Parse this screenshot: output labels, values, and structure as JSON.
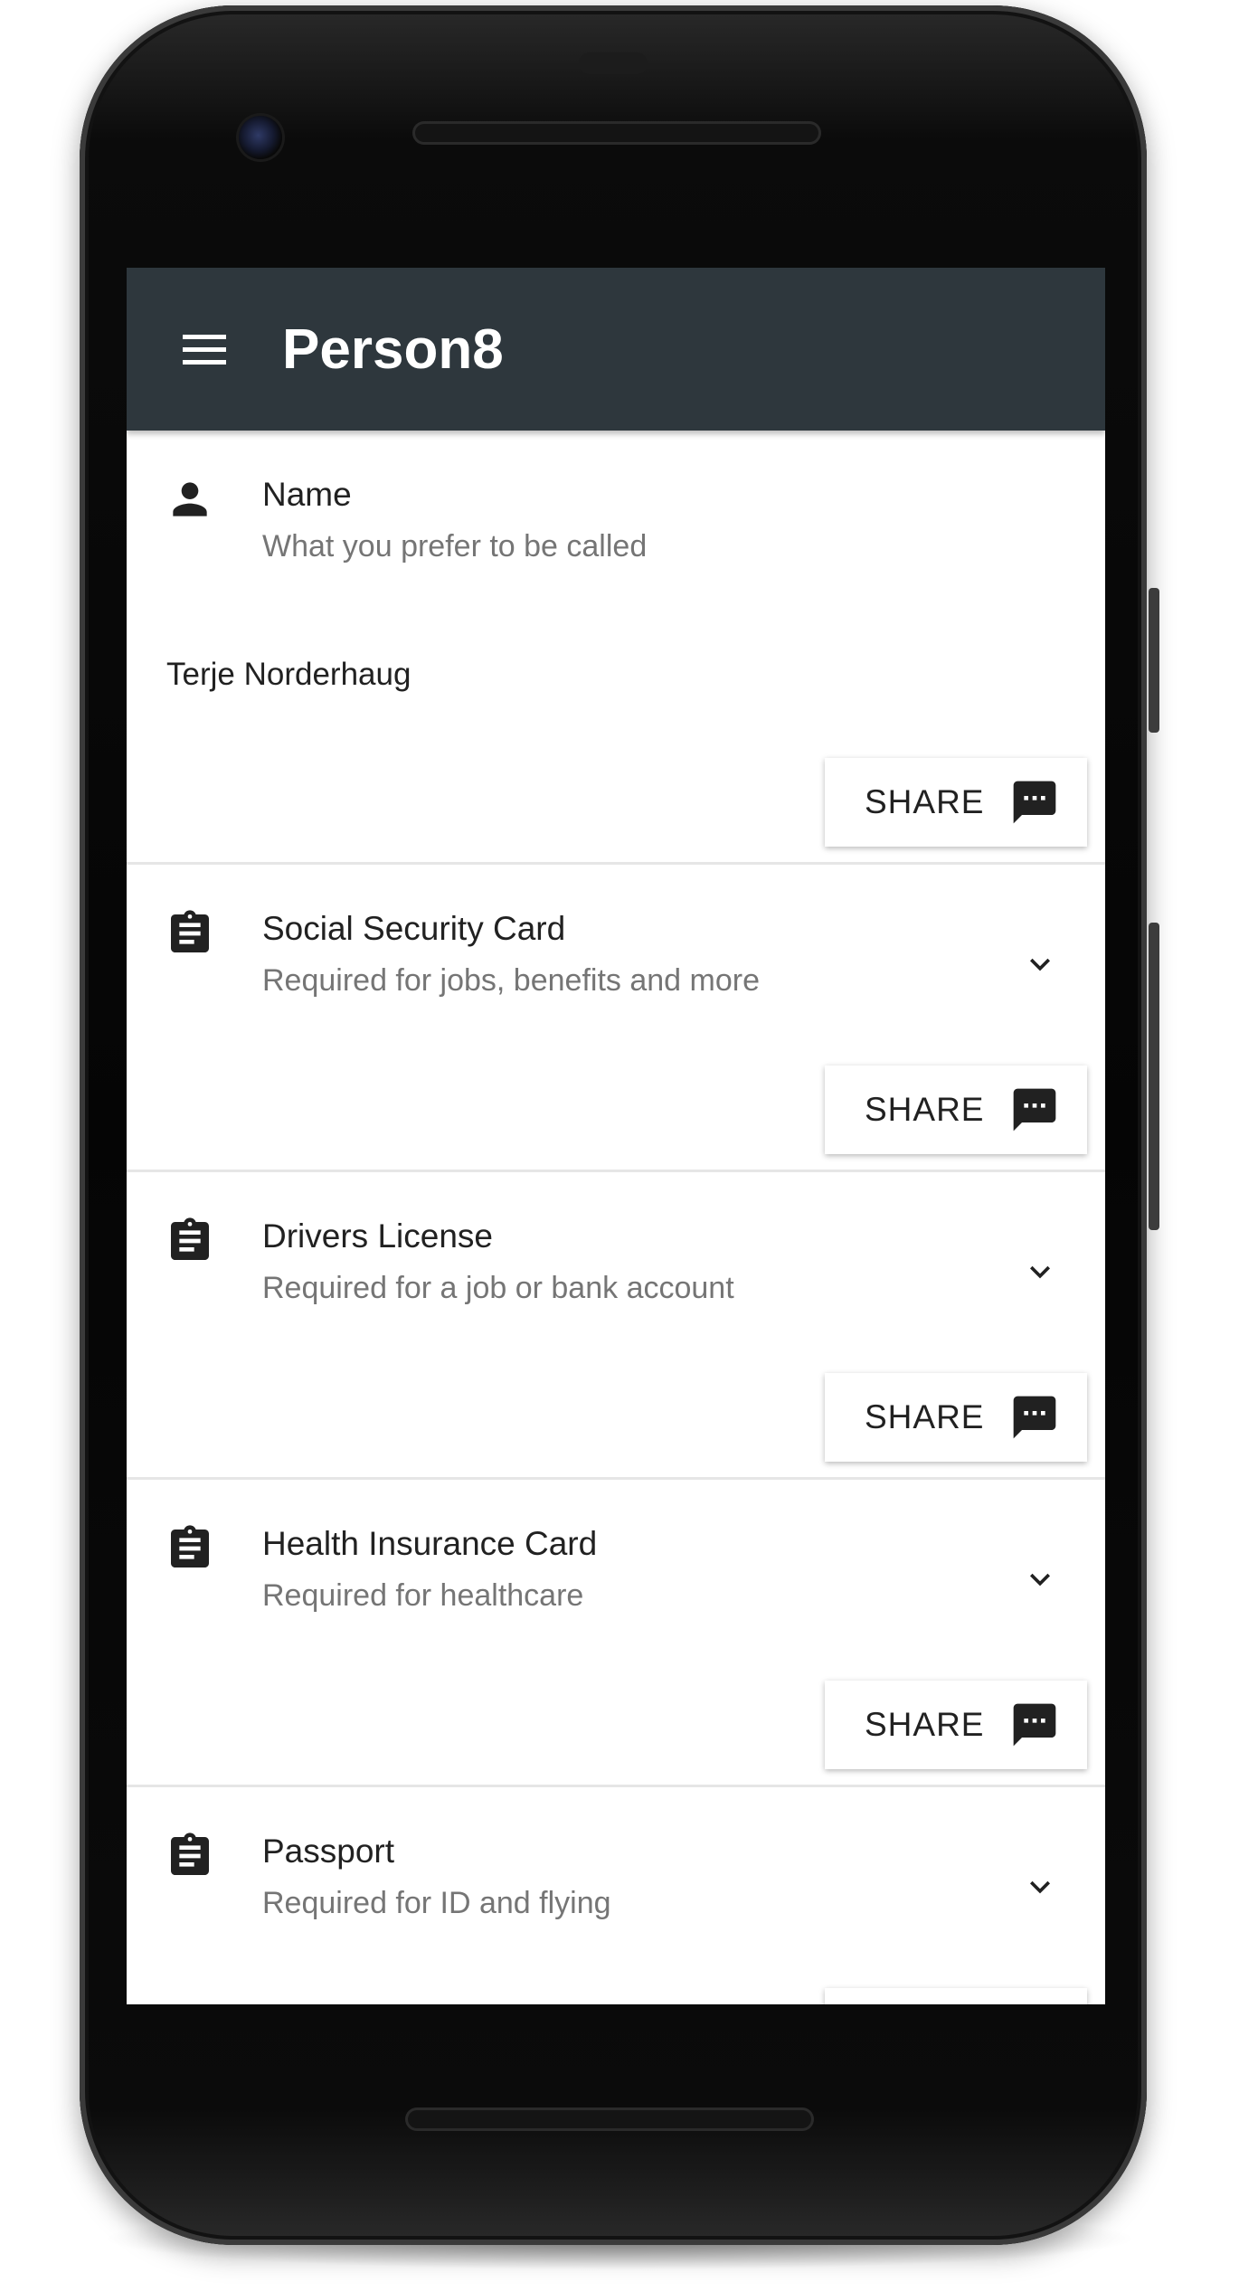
{
  "app": {
    "title": "Person8",
    "menu_icon": "hamburger-menu-icon",
    "appbar_color": "#2e373d"
  },
  "cards": [
    {
      "icon": "person-icon",
      "title": "Name",
      "subtitle": "What you prefer to be called",
      "value": "Terje Norderhaug",
      "share_label": "SHARE"
    },
    {
      "icon": "clipboard-icon",
      "title": "Social Security Card",
      "subtitle": "Required for jobs, benefits and more",
      "expandable": true,
      "share_label": "SHARE"
    },
    {
      "icon": "clipboard-icon",
      "title": "Drivers License",
      "subtitle": "Required for a job or bank account",
      "expandable": true,
      "share_label": "SHARE"
    },
    {
      "icon": "clipboard-icon",
      "title": "Health Insurance Card",
      "subtitle": "Required for healthcare",
      "expandable": true,
      "share_label": "SHARE"
    },
    {
      "icon": "clipboard-icon",
      "title": "Passport",
      "subtitle": "Required for ID and flying",
      "expandable": true
    }
  ]
}
